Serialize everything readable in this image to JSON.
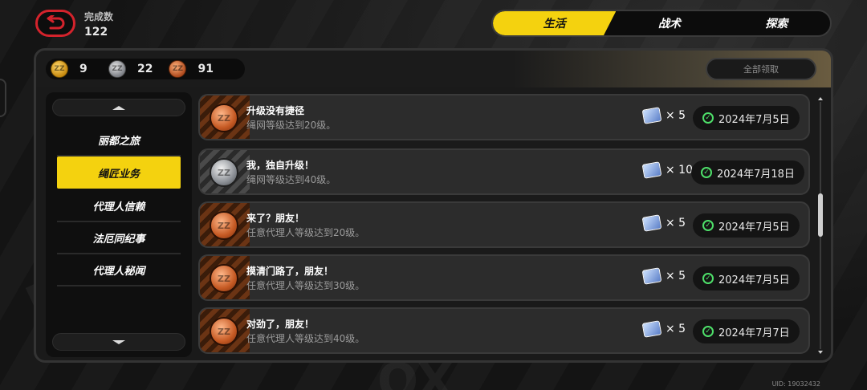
{
  "header": {
    "count_label": "完成数",
    "count_value": "122"
  },
  "tabs": [
    {
      "label": "生活",
      "active": true
    },
    {
      "label": "战术",
      "active": false
    },
    {
      "label": "探索",
      "active": false
    }
  ],
  "currency": {
    "gold": "9",
    "silver": "22",
    "bronze": "91"
  },
  "claim_all_label": "全部领取",
  "sidebar": {
    "items": [
      {
        "label": "丽都之旅",
        "active": false
      },
      {
        "label": "绳匠业务",
        "active": true
      },
      {
        "label": "代理人信赖",
        "active": false
      },
      {
        "label": "法厄同纪事",
        "active": false
      },
      {
        "label": "代理人秘闻",
        "active": false
      }
    ]
  },
  "achievements": [
    {
      "title": "升级没有捷径",
      "desc": "绳网等级达到20级。",
      "medal": "bronze",
      "reward_qty": "× 5",
      "date": "2024年7月5日"
    },
    {
      "title": "我，独自升级！",
      "desc": "绳网等级达到40级。",
      "medal": "silver",
      "reward_qty": "× 10",
      "date": "2024年7月18日"
    },
    {
      "title": "来了？朋友！",
      "desc": "任意代理人等级达到20级。",
      "medal": "bronze",
      "reward_qty": "× 5",
      "date": "2024年7月5日"
    },
    {
      "title": "摸清门路了，朋友！",
      "desc": "任意代理人等级达到30级。",
      "medal": "bronze",
      "reward_qty": "× 5",
      "date": "2024年7月5日"
    },
    {
      "title": "对劲了，朋友！",
      "desc": "任意代理人等级达到40级。",
      "medal": "bronze",
      "reward_qty": "× 5",
      "date": "2024年7月7日"
    }
  ],
  "uid": "UID: 19032432",
  "colors": {
    "accent_yellow": "#f4d20f",
    "back_red": "#d4232c",
    "check_green": "#4ee06a"
  },
  "icons": {
    "back": "return-arrow-icon",
    "reward": "ticket-icon",
    "status": "check-circle-icon"
  }
}
